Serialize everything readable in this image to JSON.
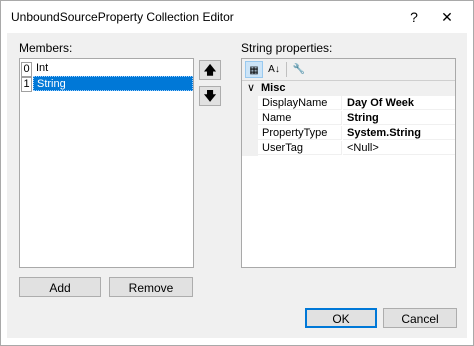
{
  "window": {
    "title": "UnboundSourceProperty Collection Editor",
    "help_glyph": "?",
    "close_glyph": "✕"
  },
  "members": {
    "label": "Members:",
    "items": [
      {
        "index": "0",
        "name": "Int",
        "selected": false
      },
      {
        "index": "1",
        "name": "String",
        "selected": true
      }
    ],
    "move_up_glyph": "🡅",
    "move_down_glyph": "🡇",
    "add_label": "Add",
    "remove_label": "Remove"
  },
  "properties": {
    "label": "String properties:",
    "toolbar": {
      "categorized_icon": "categorized-icon",
      "alphabetical_icon": "alphabetical-icon",
      "property_pages_icon": "property-pages-icon",
      "categorized_glyph": "▦",
      "alphabetical_glyph": "A↓",
      "property_pages_glyph": "🔧"
    },
    "category": {
      "chevron": "∨",
      "name": "Misc"
    },
    "rows": [
      {
        "name": "DisplayName",
        "value": "Day Of Week",
        "bold": true
      },
      {
        "name": "Name",
        "value": "String",
        "bold": true
      },
      {
        "name": "PropertyType",
        "value": "System.String",
        "bold": true
      },
      {
        "name": "UserTag",
        "value": "<Null>",
        "bold": false
      }
    ]
  },
  "footer": {
    "ok_label": "OK",
    "cancel_label": "Cancel"
  },
  "colors": {
    "selection": "#0078d7",
    "default_button_border": "#0078d7",
    "dialog_background": "#f0f0f0"
  }
}
